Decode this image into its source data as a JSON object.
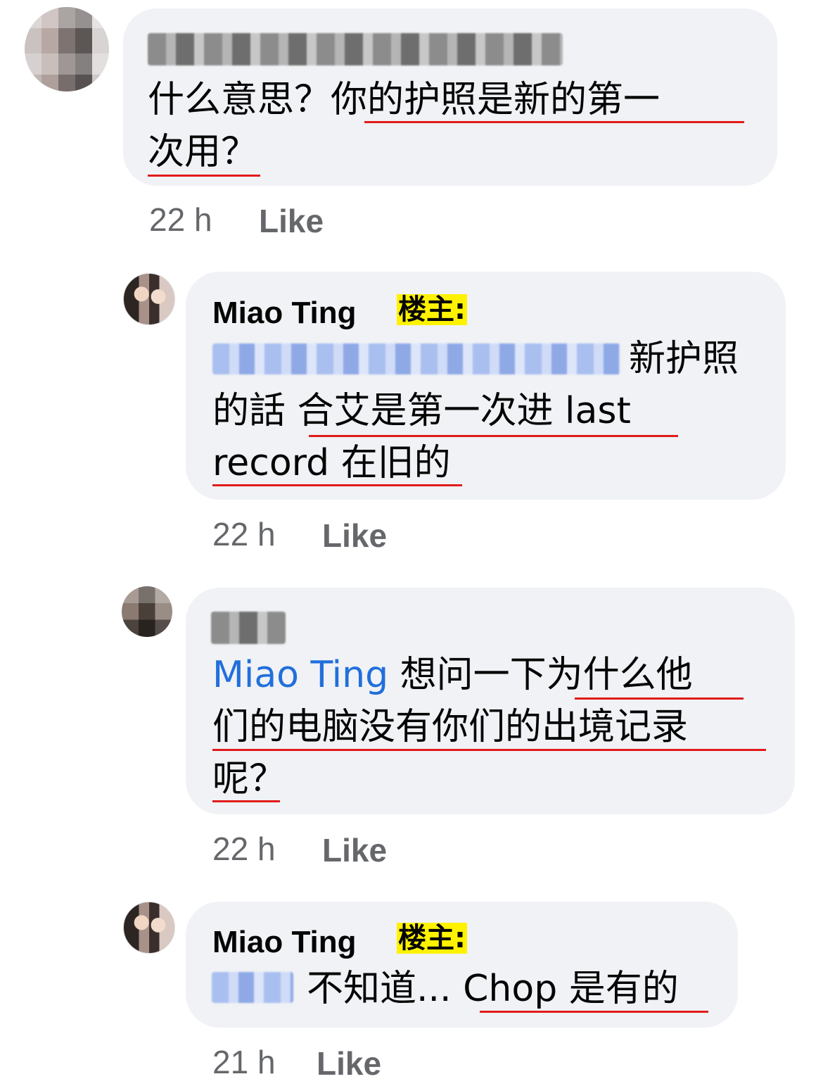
{
  "comments": [
    {
      "line1": "什么意思？你的护照是新的第一",
      "line2": "次用？",
      "time": "22 h",
      "like": "Like"
    },
    {
      "author": "Miao Ting",
      "badge": "楼主:",
      "line1_suffix": "新护照",
      "line2": "的話 合艾是第一次进 last",
      "line3": "record 在旧的",
      "time": "22 h",
      "like": "Like"
    },
    {
      "mention": "Miao Ting",
      "line1_suffix": "想问一下为什么他",
      "line2": "们的电脑没有你们的出境记录",
      "line3": "呢？",
      "time": "22 h",
      "like": "Like"
    },
    {
      "author": "Miao Ting",
      "badge": "楼主:",
      "line1_suffix": "不知道... Chop 是有的",
      "time": "21 h",
      "like": "Like"
    }
  ],
  "colors": {
    "bubble": "#f0f2f5",
    "underline": "#e21b1b",
    "mention": "#216fdb",
    "badge": "#fff200",
    "meta": "#65676b"
  }
}
